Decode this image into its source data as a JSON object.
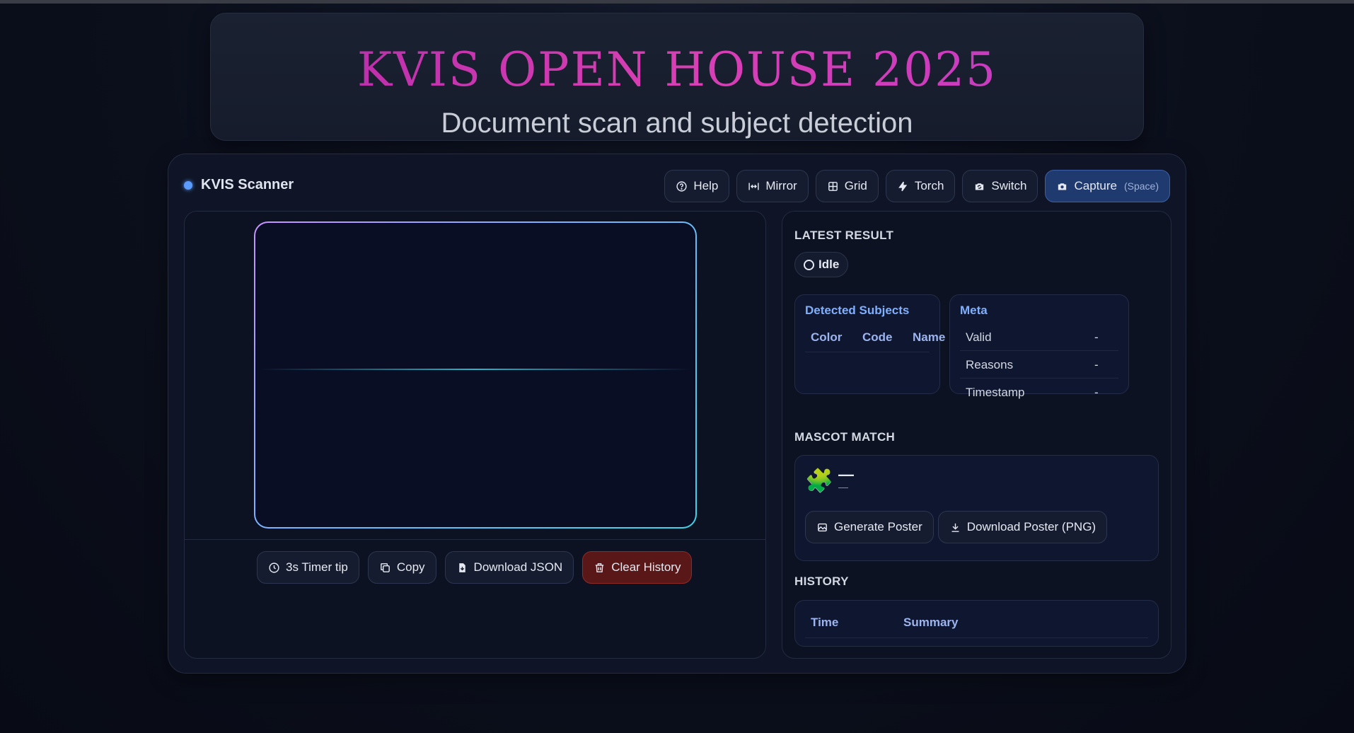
{
  "hero": {
    "title": "KVIS OPEN HOUSE 2025",
    "subtitle": "Document scan and subject detection"
  },
  "app": {
    "name": "KVIS Scanner",
    "status_dot_color": "#5b9cff"
  },
  "toolbar": {
    "help": "Help",
    "mirror": "Mirror",
    "grid": "Grid",
    "torch": "Torch",
    "switch": "Switch",
    "capture": "Capture",
    "capture_hint": "(Space)"
  },
  "scanner_actions": {
    "timer": "3s Timer tip",
    "copy": "Copy",
    "download_json": "Download JSON",
    "clear_history": "Clear History"
  },
  "latest_result": {
    "title": "LATEST RESULT",
    "status": "Idle",
    "subjects": {
      "title": "Detected Subjects",
      "columns": [
        "Color",
        "Code",
        "Name"
      ],
      "rows": []
    },
    "meta": {
      "title": "Meta",
      "rows": [
        {
          "key": "Valid",
          "value": "-"
        },
        {
          "key": "Reasons",
          "value": "-"
        },
        {
          "key": "Timestamp",
          "value": "-"
        }
      ]
    }
  },
  "mascot": {
    "title": "MASCOT MATCH",
    "icon": "puzzle-icon",
    "name": "—",
    "subtitle": "—",
    "generate": "Generate Poster",
    "download": "Download Poster (PNG)"
  },
  "history": {
    "title": "HISTORY",
    "columns": [
      "Time",
      "Summary"
    ],
    "rows": []
  },
  "colors": {
    "accent": "#5b9cff",
    "title_gradient_start": "#b12aa8",
    "title_gradient_end": "#c23ac4",
    "danger": "#5a1717",
    "primary": "#1f3a6e"
  }
}
